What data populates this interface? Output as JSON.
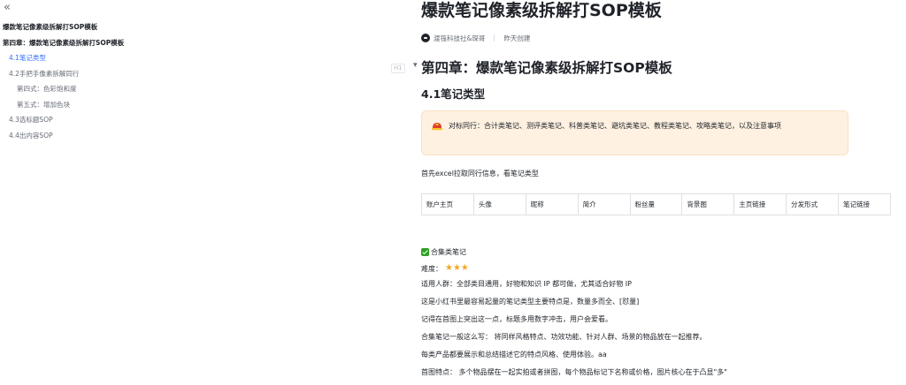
{
  "outline": {
    "collapse_glyph": "«",
    "items": [
      {
        "label": "爆款笔记像素级拆解打SOP模板",
        "level": 0,
        "active": false
      },
      {
        "label": "第四章：爆款笔记像素级拆解打SOP模板",
        "level": 1,
        "active": false
      },
      {
        "label": "4.1笔记类型",
        "level": 2,
        "active": true
      },
      {
        "label": "4.2手把手像素拆解同行",
        "level": 2,
        "active": false
      },
      {
        "label": "第四式：色彩饱和度",
        "level": 3,
        "active": false
      },
      {
        "label": "第五式：增加色块",
        "level": 3,
        "active": false
      },
      {
        "label": "4.3选标题SOP",
        "level": 2,
        "active": false
      },
      {
        "label": "4.4出内容SOP",
        "level": 2,
        "active": false
      }
    ]
  },
  "document": {
    "title": "爆款笔记像素级拆解打SOP模板",
    "author": "渡筏科技社&琛哥",
    "created": "昨天创建",
    "h1_tag": "H1",
    "h1": "第四章：爆款笔记像素级拆解打SOP模板",
    "h2": "4.1笔记类型",
    "callout": "对标同行：合计类笔记、测评类笔记、科普类笔记、避坑类笔记、教程类笔记、攻略类笔记，以及注意事项",
    "intro": "首先excel拉取同行信息，看笔记类型",
    "table_headers": [
      "账户主页",
      "头像",
      "昵称",
      "简介",
      "粉丝量",
      "背景图",
      "主页链接",
      "分发形式",
      "笔记链接"
    ],
    "checklist_label": "合集类笔记",
    "difficulty_label": "难度：",
    "difficulty_stars": "★★★",
    "lines": [
      "适用人群：全部类目通用，好物和知识 IP 都可做，尤其适合好物 IP",
      "这是小红书里最容易起量的笔记类型主要特点是，数量多而全、[怼量]",
      "记得在首图上突出这一点，标题多用数字冲击，用户会爱看。",
      "合集笔记一般这么写： 将同样风格特点、功效功能、针对人群、场景的物品放在一起推荐。",
      "每类产品都要展示和总结描述它的特点风格、使用体验。aa",
      "首图特点： 多个物品摆在一起实拍或者拼图，每个物品标记下名称或价格，图片核心在于凸显\"多\""
    ]
  },
  "colors": {
    "accent_blue": "#3370ff",
    "callout_bg": "#fef1e1",
    "check_green": "#2ea121",
    "star_gold": "#f5a623"
  }
}
